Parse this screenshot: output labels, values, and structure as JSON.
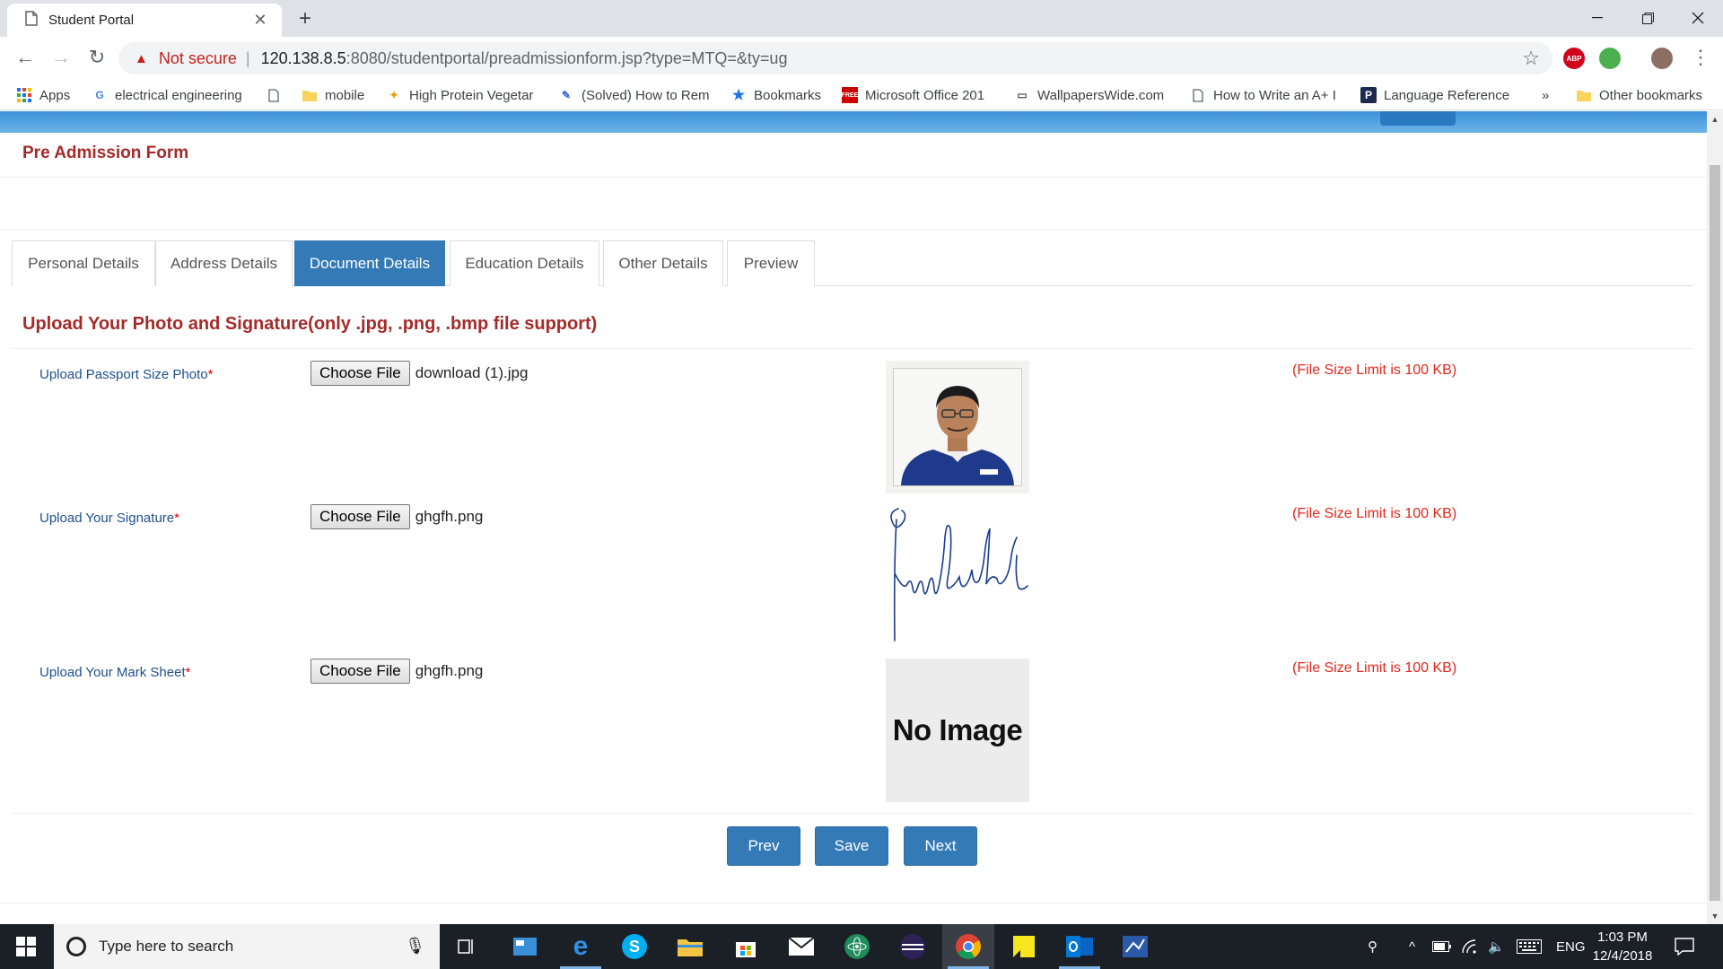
{
  "browser": {
    "tab_title": "Student Portal",
    "security_label": "Not secure",
    "url_host": "120.138.8.5",
    "url_rest": ":8080/studentportal/preadmissionform.jsp?type=MTQ=&ty=ug",
    "bookmarks": [
      {
        "label": "Apps",
        "icon": "apps-grid-icon"
      },
      {
        "label": "electrical engineering",
        "icon": "google-icon"
      },
      {
        "label": "",
        "icon": "page-icon"
      },
      {
        "label": "mobile",
        "icon": "folder-icon"
      },
      {
        "label": "High Protein Vegetar",
        "icon": "fitness-icon"
      },
      {
        "label": "(Solved) How to Rem",
        "icon": "solved-icon"
      },
      {
        "label": "Bookmarks",
        "icon": "star-icon"
      },
      {
        "label": "Microsoft Office 201",
        "icon": "office-icon"
      },
      {
        "label": "WallpapersWide.com",
        "icon": "wallpaper-icon"
      },
      {
        "label": "How to Write an A+ I",
        "icon": "page-icon"
      },
      {
        "label": "Language Reference",
        "icon": "p-icon"
      },
      {
        "label": "»",
        "icon": ""
      },
      {
        "label": "Other bookmarks",
        "icon": "folder-icon"
      }
    ],
    "extensions": [
      "ABP"
    ]
  },
  "page": {
    "title": "Pre Admission Form",
    "tabs": [
      {
        "label": "Personal Details",
        "active": false
      },
      {
        "label": "Address Details",
        "active": false
      },
      {
        "label": "Document Details",
        "active": true
      },
      {
        "label": "Education Details",
        "active": false
      },
      {
        "label": "Other Details",
        "active": false
      },
      {
        "label": "Preview",
        "active": false
      }
    ],
    "section_title": "Upload Your Photo and Signature(only .jpg, .png, .bmp file support)",
    "fields": [
      {
        "label": "Upload Passport Size Photo",
        "required_mark": "*",
        "button_label": "Choose File",
        "file_name": "download (1).jpg",
        "size_limit": "(File Size Limit is 100 KB)",
        "preview": "photo"
      },
      {
        "label": "Upload Your Signature",
        "required_mark": "*",
        "button_label": "Choose File",
        "file_name": "ghgfh.png",
        "size_limit": "(File Size Limit is 100 KB)",
        "preview": "signature"
      },
      {
        "label": "Upload Your Mark Sheet",
        "required_mark": "*",
        "button_label": "Choose File",
        "file_name": "ghgfh.png",
        "size_limit": "(File Size Limit is 100 KB)",
        "preview": "no-image"
      }
    ],
    "no_image_text": "No Image",
    "buttons": {
      "prev": "Prev",
      "save": "Save",
      "next": "Next"
    },
    "colors": {
      "accent_blue": "#337ab7",
      "title_red": "#a52a2a",
      "limit_red": "#e3261b",
      "label_blue": "#1f4f8f"
    }
  },
  "taskbar": {
    "search_placeholder": "Type here to search",
    "language": "ENG",
    "time": "1:03 PM",
    "date": "12/4/2018"
  }
}
